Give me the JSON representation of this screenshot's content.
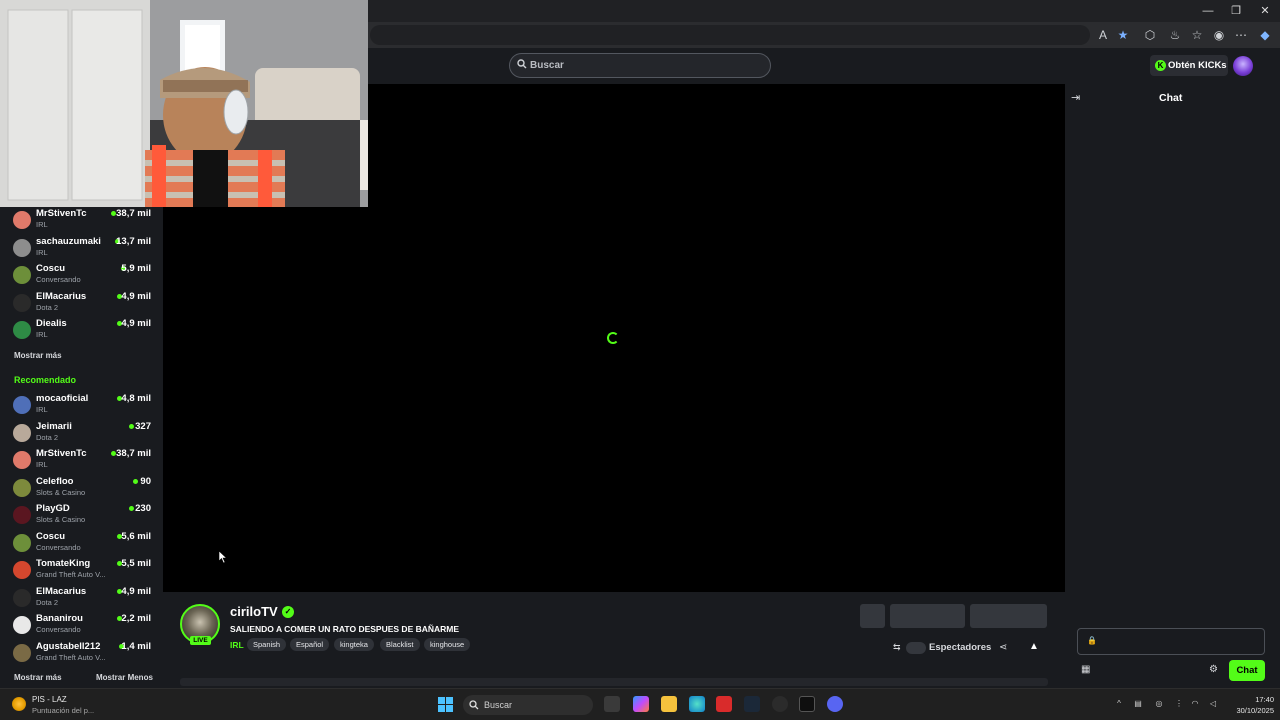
{
  "header": {
    "search_placeholder": "Buscar",
    "kicks_label": "Obtén KICKs"
  },
  "sidebar": {
    "followed": [
      {
        "name": "MrStivenTc",
        "category": "IRL",
        "viewers": "38,7 mil"
      },
      {
        "name": "sachauzumaki",
        "category": "IRL",
        "viewers": "13,7 mil"
      },
      {
        "name": "Coscu",
        "category": "Conversando",
        "viewers": "5,9 mil"
      },
      {
        "name": "ElMacarius",
        "category": "Dota 2",
        "viewers": "4,9 mil"
      },
      {
        "name": "Diealis",
        "category": "IRL",
        "viewers": "4,9 mil"
      }
    ],
    "show_more_1": "Mostrar más",
    "recommended_title": "Recomendado",
    "recommended": [
      {
        "name": "mocaoficial",
        "category": "IRL",
        "viewers": "4,8 mil"
      },
      {
        "name": "Jeimarii",
        "category": "Dota 2",
        "viewers": "327"
      },
      {
        "name": "MrStivenTc",
        "category": "IRL",
        "viewers": "38,7 mil"
      },
      {
        "name": "Celefloo",
        "category": "Slots & Casino",
        "viewers": "90"
      },
      {
        "name": "PlayGD",
        "category": "Slots & Casino",
        "viewers": "230"
      },
      {
        "name": "Coscu",
        "category": "Conversando",
        "viewers": "5,6 mil"
      },
      {
        "name": "TomateKing",
        "category": "Grand Theft Auto V...",
        "viewers": "5,5 mil"
      },
      {
        "name": "ElMacarius",
        "category": "Dota 2",
        "viewers": "4,9 mil"
      },
      {
        "name": "Bananirou",
        "category": "Conversando",
        "viewers": "2,2 mil"
      },
      {
        "name": "Agustabell212",
        "category": "Grand Theft Auto V...",
        "viewers": "1,4 mil"
      }
    ],
    "show_more_2": "Mostrar más",
    "show_less": "Mostrar Menos"
  },
  "stream": {
    "streamer": "ciriloTV",
    "live_badge": "LIVE",
    "title": "SALIENDO A COMER UN RATO DESPUES DE BAÑARME",
    "category": "IRL",
    "tags": [
      "Spanish",
      "Español",
      "kingteka",
      "Blacklist",
      "kinghouse"
    ],
    "viewers_label": "Espectadores"
  },
  "chat": {
    "title": "Chat",
    "send_label": "Chat"
  },
  "taskbar": {
    "weather_line1": "PIS - LAZ",
    "weather_line2": "Puntuación del p...",
    "search_label": "Buscar",
    "time": "17:40",
    "date": "30/10/2025"
  },
  "colors": {
    "accent": "#53fc18",
    "background": "#191b1f",
    "player": "#000000"
  }
}
